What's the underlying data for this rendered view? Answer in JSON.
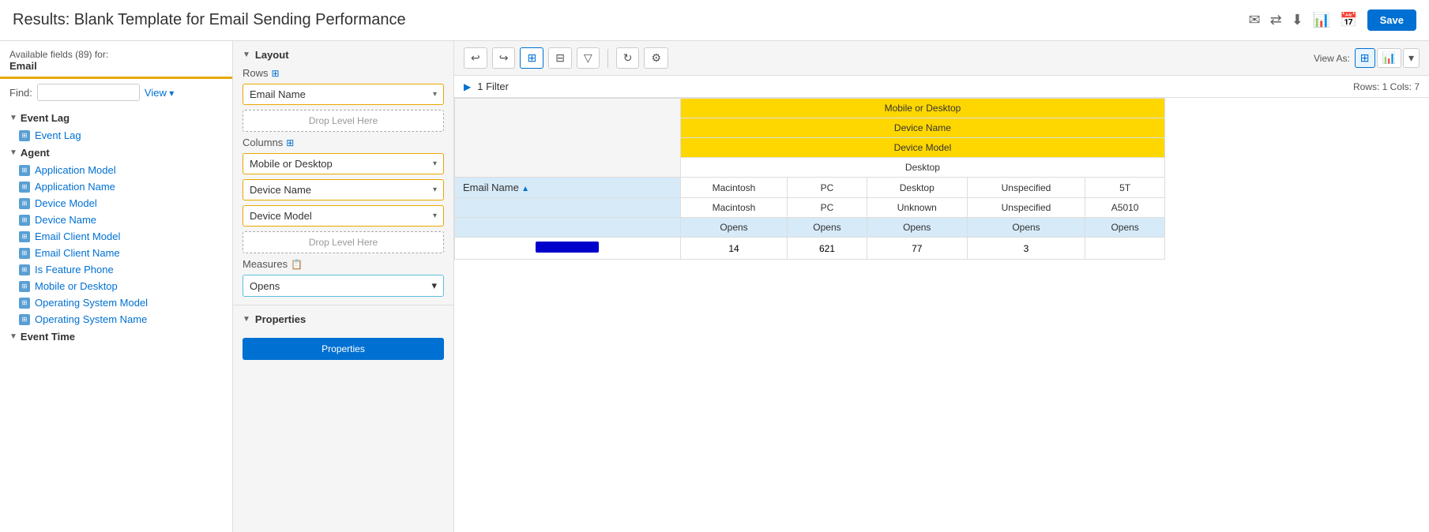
{
  "header": {
    "title": "Results: Blank Template for Email Sending Performance",
    "save_label": "Save",
    "icons": [
      "email-icon",
      "share-icon",
      "download-icon",
      "chart-icon",
      "calendar-icon"
    ]
  },
  "left_panel": {
    "available_fields_label": "Available fields (89) for:",
    "context": "Email",
    "find_label": "Find:",
    "find_placeholder": "",
    "view_label": "View",
    "groups": [
      {
        "name": "Event Lag",
        "expanded": true,
        "items": [
          "Event Lag"
        ]
      },
      {
        "name": "Agent",
        "expanded": true,
        "items": [
          "Application Model",
          "Application Name",
          "Device Model",
          "Device Name",
          "Email Client Model",
          "Email Client Name",
          "Is Feature Phone",
          "Mobile or Desktop",
          "Operating System Model",
          "Operating System Name"
        ]
      },
      {
        "name": "Event Time",
        "expanded": false,
        "items": []
      }
    ]
  },
  "middle_panel": {
    "layout_label": "Layout",
    "rows_label": "Rows",
    "columns_label": "Columns",
    "measures_label": "Measures",
    "properties_label": "Properties",
    "rows": [
      {
        "label": "Email Name"
      }
    ],
    "columns": [
      {
        "label": "Mobile or Desktop"
      },
      {
        "label": "Device Name"
      },
      {
        "label": "Device Model"
      }
    ],
    "measures": [
      {
        "label": "Opens"
      }
    ],
    "drop_level_here": "Drop Level Here",
    "properties_btn_label": "Properties"
  },
  "toolbar": {
    "undo_label": "↩",
    "redo_label": "↪",
    "grid_view_label": "⊞",
    "split_view_label": "⊟",
    "filter_label": "▽",
    "refresh_label": "↻",
    "settings_label": "⚙",
    "view_as_label": "View As:",
    "view_table_label": "⊞",
    "view_chart_label": "📊"
  },
  "filter_bar": {
    "filter_count": "1 Filter",
    "rows_cols": "Rows: 1  Cols: 7"
  },
  "table": {
    "row_headers": {
      "col1_span1": "Mobile or Desktop",
      "col1_span2": "Device Name",
      "col1_span3": "Device Model"
    },
    "desktop_header": "Desktop",
    "columns": [
      {
        "level2": "Macintosh",
        "level3": "Macintosh",
        "metric": "Opens"
      },
      {
        "level2": "PC",
        "level3": "PC",
        "metric": "Opens"
      },
      {
        "level2": "Desktop",
        "level3": "Unknown",
        "metric": "Opens"
      },
      {
        "level2": "Unspecified",
        "level3": "Unspecified",
        "metric": "Opens"
      },
      {
        "level2": "5T",
        "level3": "A5010",
        "metric": "Opens"
      }
    ],
    "email_name_col": "Email Name",
    "rows": [
      {
        "email": "",
        "values": [
          "14",
          "621",
          "77",
          "3",
          ""
        ]
      }
    ]
  }
}
